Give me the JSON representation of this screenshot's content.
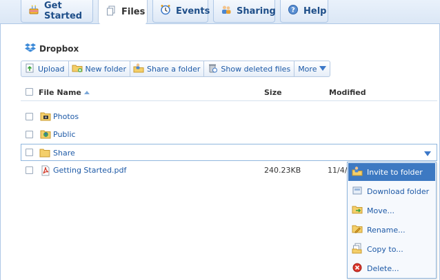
{
  "tabs": [
    {
      "label": "Get Started",
      "icon": "cake-icon"
    },
    {
      "label": "Files",
      "icon": "files-icon"
    },
    {
      "label": "Events",
      "icon": "clock-icon"
    },
    {
      "label": "Sharing",
      "icon": "people-icon"
    },
    {
      "label": "Help",
      "icon": "help-icon"
    }
  ],
  "active_tab": "Files",
  "page": {
    "title": "Dropbox"
  },
  "toolbar": {
    "upload": "Upload",
    "new_folder": "New folder",
    "share_folder": "Share a folder",
    "show_deleted": "Show deleted files",
    "more": "More"
  },
  "columns": {
    "name": "File Name",
    "size": "Size",
    "modified": "Modified"
  },
  "files": [
    {
      "name": "Photos",
      "size": "",
      "modified": "",
      "icon": "photo-folder-icon"
    },
    {
      "name": "Public",
      "size": "",
      "modified": "",
      "icon": "public-folder-icon"
    },
    {
      "name": "Share",
      "size": "",
      "modified": "",
      "icon": "folder-icon"
    },
    {
      "name": "Getting Started.pdf",
      "size": "240.23KB",
      "modified": "11/4/",
      "icon": "pdf-icon"
    }
  ],
  "context_menu": {
    "items": [
      {
        "label": "Invite to folder",
        "icon": "invite-icon"
      },
      {
        "label": "Download folder",
        "icon": "download-icon"
      },
      {
        "label": "Move...",
        "icon": "move-icon"
      },
      {
        "label": "Rename...",
        "icon": "rename-icon"
      },
      {
        "label": "Copy to...",
        "icon": "copy-icon"
      },
      {
        "label": "Delete...",
        "icon": "delete-icon"
      }
    ],
    "highlighted": "Invite to folder"
  },
  "colors": {
    "link": "#1d59a6",
    "accent": "#3d79c2",
    "border": "#aec7e6"
  }
}
